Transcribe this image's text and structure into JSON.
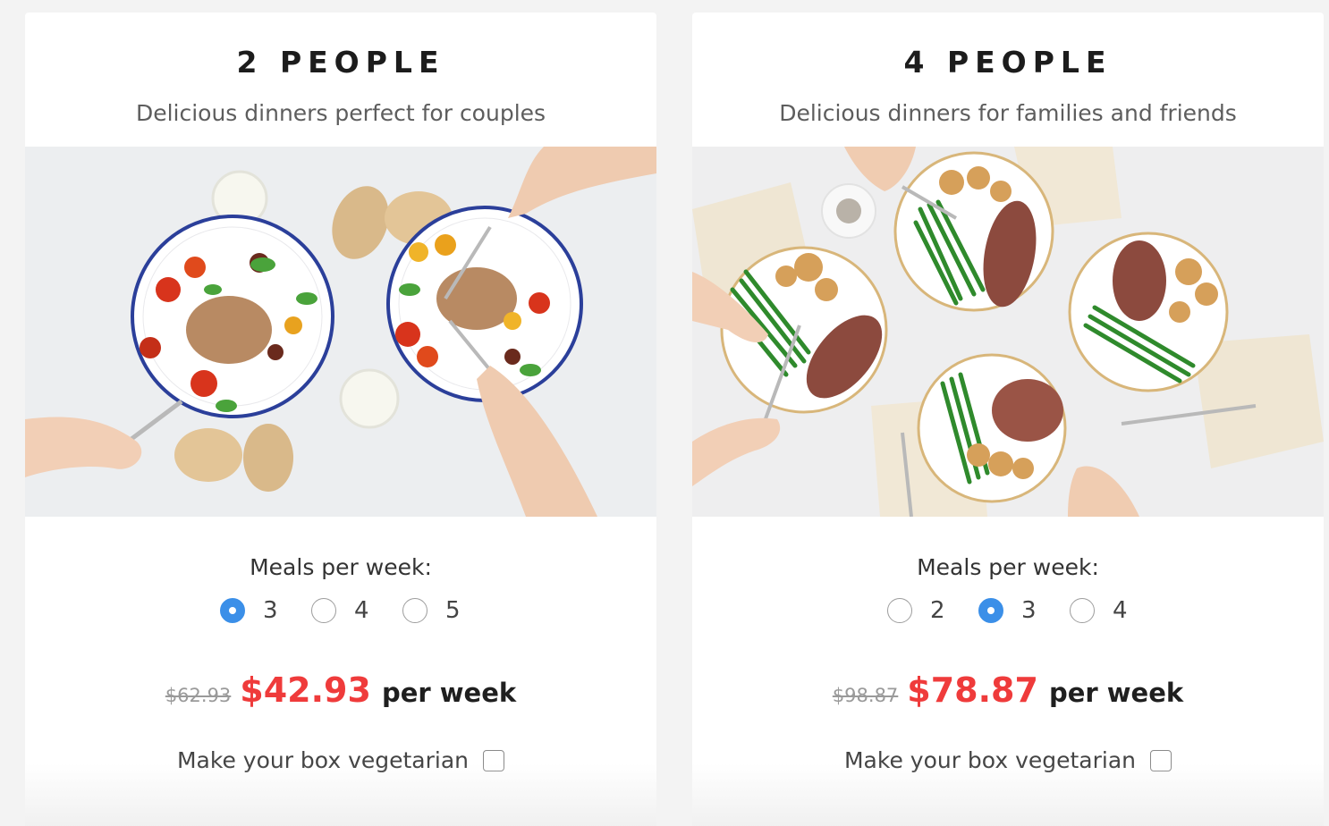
{
  "plans": [
    {
      "title": "2 PEOPLE",
      "subtitle": "Delicious dinners perfect for couples",
      "photo_icon": "couple-dinner-photo",
      "meals_label": "Meals per week:",
      "options": [
        {
          "label": "3",
          "checked": true
        },
        {
          "label": "4",
          "checked": false
        },
        {
          "label": "5",
          "checked": false
        }
      ],
      "old_price": "$62.93",
      "price": "$42.93",
      "per_week": "per week",
      "vegetarian_label": "Make your box vegetarian",
      "vegetarian_checked": false
    },
    {
      "title": "4 PEOPLE",
      "subtitle": "Delicious dinners for families and friends",
      "photo_icon": "family-dinner-photo",
      "meals_label": "Meals per week:",
      "options": [
        {
          "label": "2",
          "checked": false
        },
        {
          "label": "3",
          "checked": true
        },
        {
          "label": "4",
          "checked": false
        }
      ],
      "old_price": "$98.87",
      "price": "$78.87",
      "per_week": "per week",
      "vegetarian_label": "Make your box vegetarian",
      "vegetarian_checked": false
    }
  ],
  "colors": {
    "accent_radio": "#3b8fe8",
    "sale_price": "#ef3b3b",
    "strike_price": "#9a9a9a",
    "background": "#f3f3f3"
  }
}
